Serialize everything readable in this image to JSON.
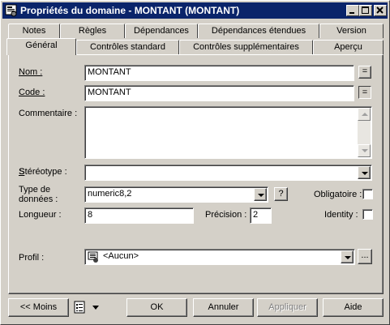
{
  "window": {
    "title": "Propriétés du domaine - MONTANT (MONTANT)",
    "controls": {
      "minimize": "minimize-icon",
      "maximize": "maximize-icon",
      "close": "close-icon"
    }
  },
  "tabs_row1": [
    "Notes",
    "Règles",
    "Dépendances",
    "Dépendances étendues",
    "Version"
  ],
  "tabs_row2": [
    "Général",
    "Contrôles standard",
    "Contrôles supplémentaires",
    "Aperçu"
  ],
  "active_tab": "Général",
  "form": {
    "name_label": "Nom :",
    "name_value": "MONTANT",
    "equals_btn": "=",
    "code_label": "Code :",
    "code_value": "MONTANT",
    "comment_label": "Commentaire :",
    "comment_value": "",
    "stereotype_label": "Stéréotype :",
    "stereotype_value": "",
    "datatype_label_1": "Type de",
    "datatype_label_2": "données :",
    "datatype_value": "numeric8,2",
    "help_btn": "?",
    "mandatory_label": "Obligatoire :",
    "mandatory_checked": false,
    "length_label": "Longueur :",
    "length_value": "8",
    "precision_label": "Précision :",
    "precision_value": "2",
    "identity_label": "Identity :",
    "identity_checked": false,
    "profile_label": "Profil :",
    "profile_value": "<Aucun>",
    "ellipsis_btn": "..."
  },
  "buttons": {
    "less": "<< Moins",
    "ok": "OK",
    "cancel": "Annuler",
    "apply": "Appliquer",
    "help": "Aide"
  },
  "colors": {
    "titlebar": "#0a246a",
    "face": "#d4d0c8",
    "disabled_text": "#808080"
  }
}
